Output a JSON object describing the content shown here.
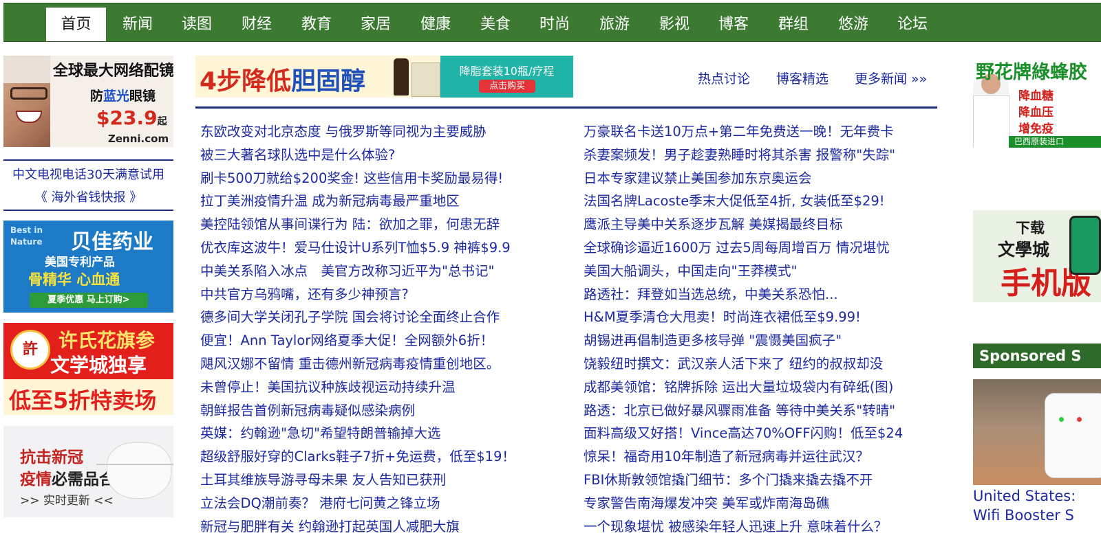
{
  "nav": {
    "items": [
      "首页",
      "新闻",
      "读图",
      "财经",
      "教育",
      "家居",
      "健康",
      "美食",
      "时尚",
      "旅游",
      "影视",
      "博客",
      "群组",
      "悠游",
      "论坛"
    ],
    "active": "首页"
  },
  "left": {
    "zenni_ad": {
      "line1": "全球最大网络配镜店",
      "line2_a": "防",
      "line2_b": "蓝光",
      "line2_c": "眼镜",
      "price": "$23.9",
      "price_suffix": "起",
      "brand": "Zenni.com"
    },
    "links": [
      "中文电视电话30天满意试用",
      "《 海外省钱快报 》"
    ],
    "bestin_ad": {
      "logo_top": "Best in",
      "logo_bottom": "Nature",
      "name": "贝佳药业",
      "sub": "美国专利产品",
      "products": "骨精华  心血通",
      "cta": "夏季优惠 马上订购>"
    },
    "ginseng_ad": {
      "seal": "許",
      "line1": "许氏花旗参",
      "line2": "文学城独享",
      "line3": "低至5折特卖场"
    },
    "covid_ad": {
      "line1": "抗击新冠",
      "line2_a": "疫情",
      "line2_b": "必需品合集",
      "line3": ">> 实时更新 <<"
    }
  },
  "center": {
    "banner": {
      "part1": "4步降低",
      "part2": "胆固醇",
      "offer": "降脂套装10瓶/疗程",
      "button": "点击购买"
    },
    "top_links": [
      "热点讨论",
      "博客精选",
      "更多新闻 »»"
    ],
    "news_left": [
      "东欧改变对北京态度 与俄罗斯等同视为主要威胁",
      "被三大著名球队选中是什么体验?",
      "刷卡500刀就给$200奖金! 这些信用卡奖励最易得!",
      "拉丁美洲疫情升温 成为新冠病毒最严重地区",
      "美控陆领馆从事间谍行为 陆：欲加之罪，何患无辞",
      "优衣库这波牛！爱马仕设计U系列T恤$5.9 神裤$9.9",
      "中美关系陷入冰点　美官方改称习近平为\"总书记\"",
      "中共官方乌鸦嘴，还有多少神预言?",
      "德多间大学关闭孔子学院 国会将讨论全面终止合作",
      "便宜！Ann Taylor网络夏季大促！全网额外6折！",
      "飓风汉娜不留情 重击德州新冠病毒疫情重创地区。",
      "未曾停止！美国抗议种族歧视运动持续升温",
      "朝鲜报告首例新冠病毒疑似感染病例",
      "英媒：约翰逊\"急切\"希望特朗普输掉大选",
      "超级舒服好穿的Clarks鞋子7折+免运费，低至$19！",
      "土耳其维族导游寻母未果 友人告知已获刑",
      "立法会DQ潮前奏？ 港府七问黄之锋立场",
      "新冠与肥胖有关 约翰逊打起英国人减肥大旗"
    ],
    "news_right": [
      "万豪联名卡送10万点+第二年免费送一晚！无年费卡",
      "杀妻案频发！男子趁妻熟睡时将其杀害 报警称\"失踪\"",
      "日本专家建议禁止美国参加东京奥运会",
      "法国名牌Lacoste季末大促低至4折, 女装低至$29!",
      "鹰派主导美中关系逐步瓦解 美媒揭最终目标",
      "全球确诊逼近1600万 过去5周每周增百万 情况堪忧",
      "美国大船调头，中国走向\"王莽模式\"",
      "路透社：拜登如当选总统，中美关系恐怕...",
      "H&M夏季清仓大甩卖！时尚连衣裙低至$9.99!",
      "胡锡进再倡制造更多核导弹 \"震慑美国疯子\"",
      "饶毅纽时撰文：武汉亲人活下来了 纽约的叔叔却没",
      "成都美领馆：铭牌拆除 运出大量垃圾袋内有碎纸(图)",
      "路透：北京已做好暴风骤雨准备 等待中美关系\"转晴\"",
      "面料高级又好搭！Vince高达70%OFF闪购！低至$24",
      "惊呆！福奇用10年制造了新冠病毒并运往武汉？",
      "FBI休斯敦领馆撬门细节：多个门撬来撬去撬不开",
      "专家警告南海爆发冲突 美军或炸南海岛礁",
      "一个现象堪忧 被感染年轻人迅速上升 意味着什么？"
    ]
  },
  "right": {
    "wild_ad": {
      "title": "野花牌綠蜂胶",
      "row1": "降血糖",
      "row2": "降血压",
      "row3": "增免疫",
      "foot": "巴西原装进口"
    },
    "app_ad": {
      "line1": "下载",
      "line2": "文學城",
      "line3": "手机版"
    },
    "sponsored_label": "Sponsored S",
    "sponsored_text1": "United States:",
    "sponsored_text2": "Wifi Booster S"
  }
}
